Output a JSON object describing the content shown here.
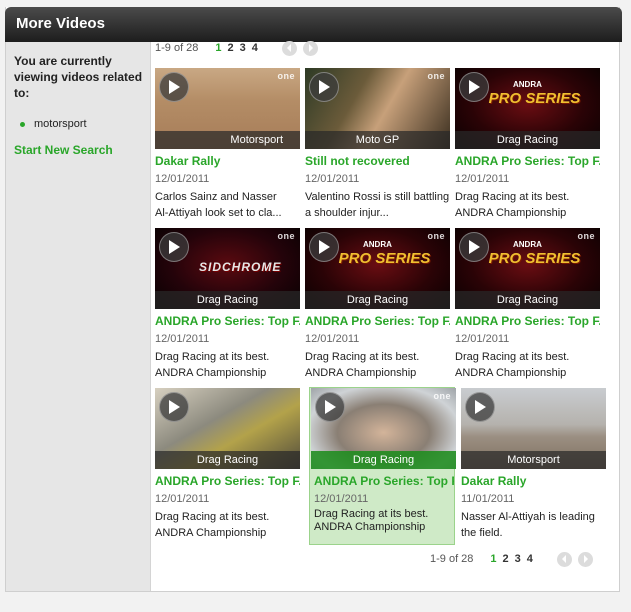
{
  "header": {
    "title": "More Videos"
  },
  "sidebar": {
    "intro": "You are currently viewing videos related to:",
    "tags": [
      "motorsport"
    ],
    "new_search_label": "Start New Search"
  },
  "pager": {
    "count_text": "1-9 of 28",
    "count_text_bottom": "1-9 of 28",
    "pages": [
      "1",
      "2",
      "3",
      "4"
    ],
    "current_page": "1",
    "prev_icon": "chevron-left-icon",
    "next_icon": "chevron-right-icon"
  },
  "channel_logo": "one",
  "videos": [
    {
      "category": "Motorsport",
      "title": "Dakar Rally",
      "date": "12/01/2011",
      "desc_line1": "Carlos Sainz and Nasser",
      "desc_line2": "Al-Attiyah look set to cla..."
    },
    {
      "category": "Moto GP",
      "title": "Still not recovered",
      "date": "12/01/2011",
      "desc_line1": "Valentino Rossi is still battling",
      "desc_line2": "a shoulder injur..."
    },
    {
      "category": "Drag Racing",
      "title": "ANDRA Pro Series: Top F..",
      "date": "12/01/2011",
      "desc_line1": "Drag Racing at its best.",
      "desc_line2": "ANDRA Championship"
    },
    {
      "category": "Drag Racing",
      "title": "ANDRA Pro Series: Top F..",
      "date": "12/01/2011",
      "desc_line1": "Drag Racing at its best.",
      "desc_line2": "ANDRA Championship"
    },
    {
      "category": "Drag Racing",
      "title": "ANDRA Pro Series: Top F..",
      "date": "12/01/2011",
      "desc_line1": "Drag Racing at its best.",
      "desc_line2": "ANDRA Championship"
    },
    {
      "category": "Drag Racing",
      "title": "ANDRA Pro Series: Top F..",
      "date": "12/01/2011",
      "desc_line1": "Drag Racing at its best.",
      "desc_line2": "ANDRA Championship"
    },
    {
      "category": "Drag Racing",
      "title": "ANDRA Pro Series: Top F..",
      "date": "12/01/2011",
      "desc_line1": "Drag Racing at its best.",
      "desc_line2": "ANDRA Championship"
    },
    {
      "category": "Drag Racing",
      "title": "ANDRA Pro Series: Top F..",
      "date": "12/01/2011",
      "desc_line1": "Drag Racing at its best.",
      "desc_line2": "ANDRA Championship"
    },
    {
      "category": "Motorsport",
      "title": "Dakar Rally",
      "date": "11/01/2011",
      "desc_line1": "Nasser Al-Attiyah is leading",
      "desc_line2": "the field."
    }
  ],
  "thumb_logos": {
    "andra_small": "ANDRA",
    "andra_big": "PRO SERIES",
    "sidechrome": "SIDCHROME"
  },
  "colors": {
    "accent_green": "#2aa62a",
    "header_dark": "#1d1d1d",
    "selected_bg": "#cfeac7"
  }
}
